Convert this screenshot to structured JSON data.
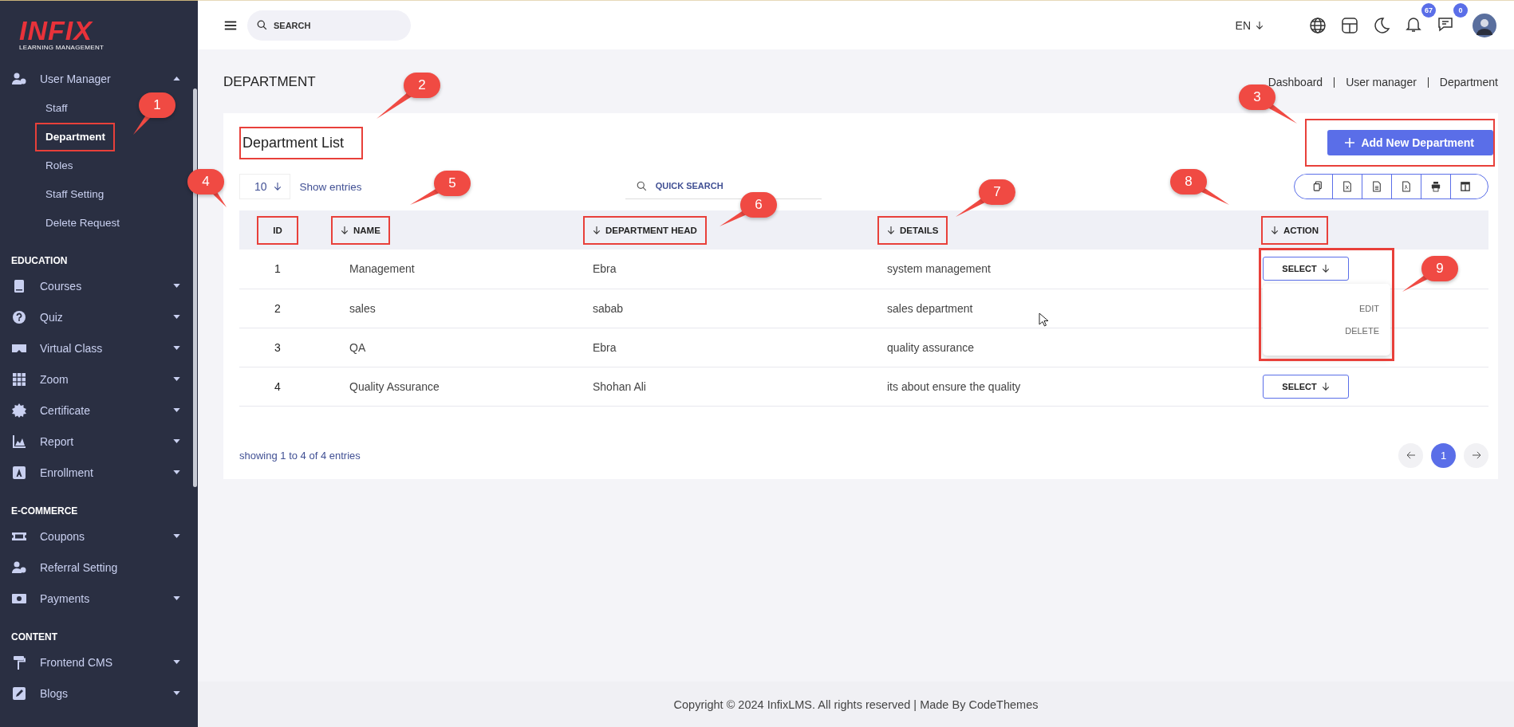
{
  "logo": {
    "brand": "INFIX",
    "tagline": "LEARNING MANAGEMENT"
  },
  "sidebar": {
    "sections": [
      {
        "items": [
          {
            "label": "User Manager",
            "kind": "group",
            "expanded": true,
            "children": [
              {
                "label": "Staff",
                "selected": false,
                "highlighted": false
              },
              {
                "label": "Department",
                "selected": true,
                "highlighted": true
              },
              {
                "label": "Roles",
                "selected": false,
                "highlighted": false
              },
              {
                "label": "Staff Setting",
                "selected": false,
                "highlighted": false
              },
              {
                "label": "Delete Request",
                "selected": false,
                "highlighted": false
              }
            ]
          }
        ]
      },
      {
        "title": "EDUCATION",
        "items": [
          {
            "label": "Courses",
            "kind": "group",
            "expanded": false
          },
          {
            "label": "Quiz",
            "kind": "group",
            "expanded": false
          },
          {
            "label": "Virtual Class",
            "kind": "group",
            "expanded": false
          },
          {
            "label": "Zoom",
            "kind": "group",
            "expanded": false
          },
          {
            "label": "Certificate",
            "kind": "group",
            "expanded": false
          },
          {
            "label": "Report",
            "kind": "group",
            "expanded": false
          },
          {
            "label": "Enrollment",
            "kind": "group",
            "expanded": false
          }
        ]
      },
      {
        "title": "E-COMMERCE",
        "items": [
          {
            "label": "Coupons",
            "kind": "group",
            "expanded": false
          },
          {
            "label": "Referral Setting",
            "kind": "link"
          },
          {
            "label": "Payments",
            "kind": "group",
            "expanded": false
          }
        ]
      },
      {
        "title": "CONTENT",
        "items": [
          {
            "label": "Frontend CMS",
            "kind": "group",
            "expanded": false
          },
          {
            "label": "Blogs",
            "kind": "group",
            "expanded": false
          }
        ]
      }
    ]
  },
  "topbar": {
    "search": {
      "placeholder": "SEARCH"
    },
    "language": "EN",
    "notifications": "67",
    "messages": "0"
  },
  "page": {
    "title": "DEPARTMENT",
    "breadcrumb": [
      "Dashboard",
      "User manager",
      "Department"
    ]
  },
  "card": {
    "title": "Department List",
    "title_highlighted": true,
    "add_button": {
      "label": "Add New Department",
      "highlighted": true
    },
    "page_size": "10",
    "show_entries": "Show entries",
    "quick_search": {
      "placeholder": "QUICK SEARCH"
    },
    "columns": [
      {
        "label": "ID",
        "sortable": false,
        "highlighted": true
      },
      {
        "label": "NAME",
        "sortable": true,
        "highlighted": true
      },
      {
        "label": "DEPARTMENT HEAD",
        "sortable": true,
        "highlighted": true
      },
      {
        "label": "DETAILS",
        "sortable": true,
        "highlighted": true
      },
      {
        "label": "ACTION",
        "sortable": true,
        "highlighted": true
      }
    ],
    "rows": [
      {
        "id": "1",
        "name": "Management",
        "head": "Ebra",
        "details": "system management",
        "action": "SELECT",
        "menu_open": true,
        "menu_highlighted": true,
        "menu": [
          "EDIT",
          "DELETE"
        ]
      },
      {
        "id": "2",
        "name": "sales",
        "head": "sabab",
        "details": "sales department",
        "menu_open": false
      },
      {
        "id": "3",
        "name": "QA",
        "head": "Ebra",
        "details": "quality assurance",
        "menu_open": false
      },
      {
        "id": "4",
        "name": "Quality Assurance",
        "head": "Shohan Ali",
        "details": "its about ensure the quality",
        "action": "SELECT",
        "menu_open": false
      }
    ],
    "summary": "showing 1 to 4 of 4 entries",
    "pages": [
      {
        "label": "1",
        "selected": true
      }
    ]
  },
  "footer": "Copyright © 2024 InfixLMS. All rights reserved | Made By CodeThemes",
  "callouts": [
    {
      "number": "1"
    },
    {
      "number": "2"
    },
    {
      "number": "3"
    },
    {
      "number": "4"
    },
    {
      "number": "5"
    },
    {
      "number": "6"
    },
    {
      "number": "7"
    },
    {
      "number": "8"
    },
    {
      "number": "9"
    }
  ]
}
